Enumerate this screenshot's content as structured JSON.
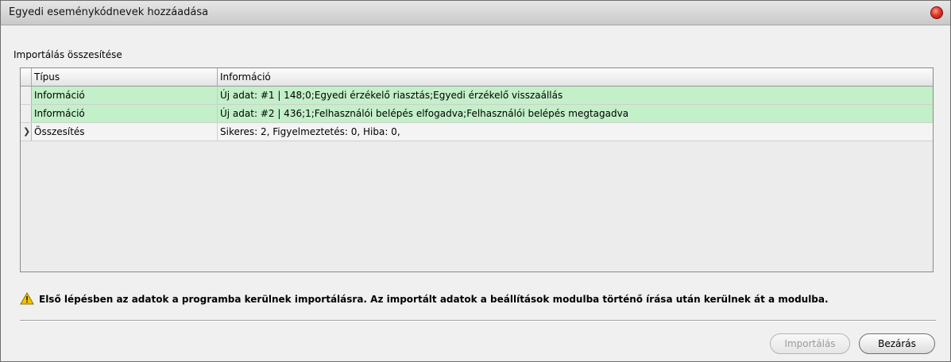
{
  "window": {
    "title": "Egyedi eseménykódnevek hozzáadása"
  },
  "summary": {
    "label": "Importálás összesítése",
    "columns": [
      "Típus",
      "Információ"
    ],
    "rows": [
      {
        "type": "Információ",
        "info": "Új adat: #1 | 148;0;Egyedi érzékelő riasztás;Egyedi érzékelő visszaállás",
        "status": "success"
      },
      {
        "type": "Információ",
        "info": "Új adat: #2 | 436;1;Felhasználói belépés elfogadva;Felhasználói belépés megtagadva",
        "status": "success"
      },
      {
        "type": "Összesítés",
        "info": "Sikeres: 2, Figyelmeztetés: 0, Hiba: 0,",
        "status": "summary",
        "current": true
      }
    ]
  },
  "warning": {
    "icon": "warning-icon",
    "text": "Első lépésben az adatok a programba kerülnek importálásra. Az importált adatok a beállítások modulba történő írása után kerülnek át a modulba."
  },
  "buttons": {
    "import_label": "Importálás",
    "import_enabled": false,
    "close_label": "Bezárás"
  },
  "colors": {
    "success_row": "#c3efc9",
    "summary_row": "#f4f4f4",
    "close_icon": "#e0392a",
    "warning_icon": "#f5c400"
  }
}
